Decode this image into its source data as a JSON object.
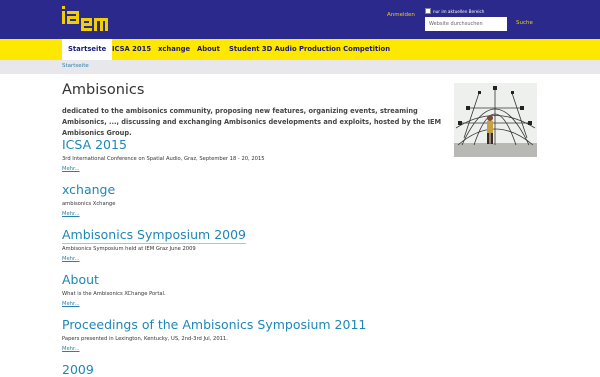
{
  "header": {
    "logo_text": "iaem",
    "login_label": "Anmelden",
    "scope_label": "nur im aktuellen Bereich",
    "search_placeholder": "Website durchsuchen",
    "search_button": "Suche"
  },
  "nav": {
    "items": [
      {
        "label": "Startseite"
      },
      {
        "label": "ICSA 2015"
      },
      {
        "label": "xchange"
      },
      {
        "label": "About"
      },
      {
        "label": "Student 3D Audio Production Competition"
      }
    ]
  },
  "breadcrumb": {
    "home": "Startseite"
  },
  "main": {
    "title": "Ambisonics",
    "intro": "dedicated to the ambisonics community, proposing new features, organizing events, streaming Ambisonics, ..., discussing and exchanging Ambisonics developments and exploits, hosted by the IEM Ambisonics Group.",
    "more_label": "Mehr...",
    "sections": [
      {
        "title": "ICSA 2015",
        "desc": "3rd International Conference on Spatial Audio, Graz, September 18 - 20, 2015"
      },
      {
        "title": "xchange",
        "desc": "ambisonics Xchange"
      },
      {
        "title": "Ambisonics Symposium 2009",
        "desc": "Ambisonics Symposium held at IEM Graz June 2009"
      },
      {
        "title": "About",
        "desc": "What is the Ambisonics XChange Portal."
      },
      {
        "title": "Proceedings of the Ambisonics Symposium 2011",
        "desc": "Papers presented in Lexington, Kentucky, US, 2nd-3rd Jul, 2011."
      },
      {
        "title": "2009",
        "desc": ""
      }
    ]
  },
  "colors": {
    "header_bg": "#2b2a8c",
    "nav_bg": "#ffe800",
    "accent": "#f0d000",
    "link": "#1e87b8"
  }
}
